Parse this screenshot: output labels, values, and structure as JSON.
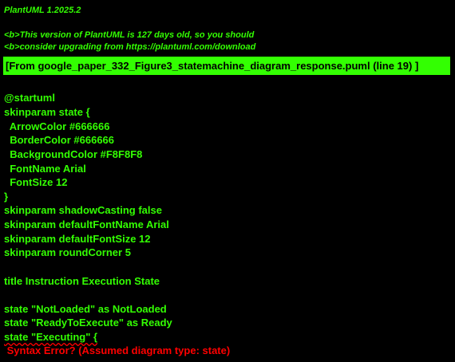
{
  "version_line": "PlantUML 1.2025.2",
  "notice": {
    "line1": "<b>This version of PlantUML is 127 days old, so you should",
    "line2": "<b>consider upgrading from https://plantuml.com/download"
  },
  "source_header": "[From google_paper_332_Figure3_statemachine_diagram_response.puml (line 19) ]",
  "code_lines": [
    "@startuml",
    "skinparam state {",
    "  ArrowColor #666666",
    "  BorderColor #666666",
    "  BackgroundColor #F8F8F8",
    "  FontName Arial",
    "  FontSize 12",
    "}",
    "skinparam shadowCasting false",
    "skinparam defaultFontName Arial",
    "skinparam defaultFontSize 12",
    "skinparam roundCorner 5",
    "",
    "title Instruction Execution State",
    "",
    "state \"NotLoaded\" as NotLoaded",
    "state \"ReadyToExecute\" as Ready",
    "state \"Executing\" {"
  ],
  "error_message": " Syntax Error? (Assumed diagram type: state)",
  "colors": {
    "background": "#000000",
    "text": "#33FF02",
    "header_bg": "#33FF02",
    "error": "#FF0000"
  }
}
